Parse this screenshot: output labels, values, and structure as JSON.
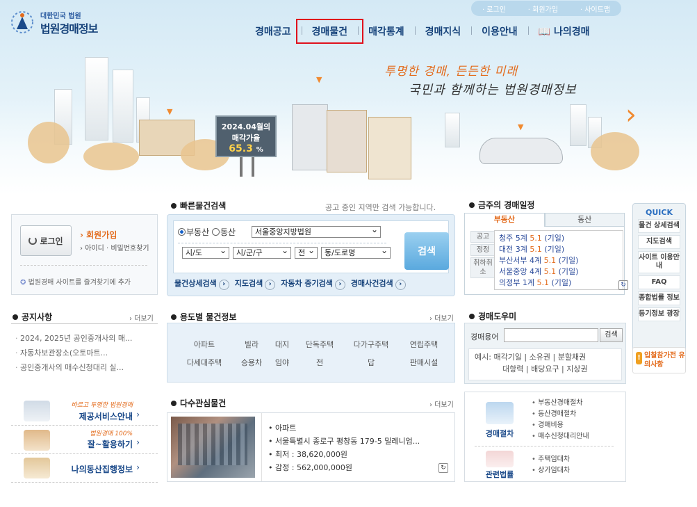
{
  "header": {
    "gov_label": "대한민국 법원",
    "site_name": "법원경매정보",
    "top_links": [
      "로그인",
      "회원가입",
      "사이트맵"
    ],
    "nav": [
      "경매공고",
      "경매물건",
      "매각통계",
      "경매지식",
      "이용안내",
      "나의경매"
    ],
    "nav_selected": "경매물건",
    "slogan1": "투명한 경매, 든든한 미래",
    "slogan2": "국민과 함께하는 법원경매정보",
    "billboard_date": "2024.04월의",
    "billboard_label": "매각가율",
    "billboard_value": "65.3",
    "billboard_unit": "%"
  },
  "login": {
    "button": "로그인",
    "join": "회원가입",
    "find": "아이디 · 비밀번호찾기",
    "favorite": "법원경매 사이트를 즐겨찾기에 추가"
  },
  "quick_search": {
    "title": "빠른물건검색",
    "note": "공고 중인 지역만 검색 가능합니다.",
    "radio_realestate": "부동산",
    "radio_movable": "동산",
    "court": "서울중앙지방법원",
    "sido": "시/도",
    "sigungu": "시/군/구",
    "all": "전",
    "dong": "동/도로명",
    "search_button": "검색",
    "links": [
      "물건상세검색",
      "지도검색",
      "자동차 중기검색",
      "경매사건검색"
    ]
  },
  "schedule": {
    "title": "금주의 경매일정",
    "tabs": [
      "부동산",
      "동산"
    ],
    "sub": [
      "공고",
      "정정",
      "취하취소"
    ],
    "items": [
      {
        "court": "청주 5계",
        "date": "5.1",
        "note": "(기일)"
      },
      {
        "court": "대전 3계",
        "date": "5.1",
        "note": "(기일)"
      },
      {
        "court": "부산서부 4계",
        "date": "5.1",
        "note": "(기일)"
      },
      {
        "court": "서울중앙 4계",
        "date": "5.1",
        "note": "(기일)"
      },
      {
        "court": "의정부 1계",
        "date": "5.1",
        "note": "(기일)"
      }
    ]
  },
  "quick": {
    "title": "QUICK",
    "items": [
      "물건 상세검색",
      "지도검색",
      "사이트 이용안내",
      "FAQ",
      "종합법률 정보",
      "등기정보 광장"
    ],
    "warning": "입찰참가전 유의사항"
  },
  "notice": {
    "title": "공지사항",
    "more": "더보기",
    "items": [
      "2024, 2025년 공인중개사의 매...",
      "자동차보관장소(오토마트...",
      "공인중개사의 매수신청대리 실..."
    ]
  },
  "usage": {
    "title": "용도별 물건정보",
    "more": "더보기",
    "row1": [
      "아파트",
      "빌라",
      "대지",
      "단독주택",
      "다가구주택",
      "연립주택"
    ],
    "row2": [
      "다세대주택",
      "승용차",
      "임야",
      "전",
      "답",
      "판매시설"
    ]
  },
  "banners": [
    {
      "tag": "바르고 투명한 법원경매",
      "label": "제공서비스안내"
    },
    {
      "tag": "법원경매 100%",
      "label": "잘~활용하기"
    },
    {
      "tag": "",
      "label": "나의동산집행정보"
    }
  ],
  "popular": {
    "title": "다수관심물건",
    "more": "더보기",
    "type": "아파트",
    "address": "서울특별시 종로구 평창동 179-5 밀레니엄...",
    "min": "최저 : 38,620,000원",
    "appraisal": "감정 : 562,000,000원"
  },
  "helper": {
    "title": "경매도우미",
    "label": "경매용어",
    "search": "검색",
    "example_label": "예시:",
    "terms1": [
      "매각기일",
      "소유권",
      "분할채권"
    ],
    "terms2": [
      "대항력",
      "배당요구",
      "지상권"
    ]
  },
  "procedure": {
    "title1": "경매절차",
    "links1": [
      "부동산경매절차",
      "동산경매절차",
      "경매비용",
      "매수신청대리안내"
    ],
    "title2": "관련법률",
    "links2": [
      "주택임대차",
      "상가임대차"
    ]
  },
  "colors": {
    "accent": "#e36b1c",
    "brand": "#16427a",
    "highlight": "#e0101c"
  }
}
